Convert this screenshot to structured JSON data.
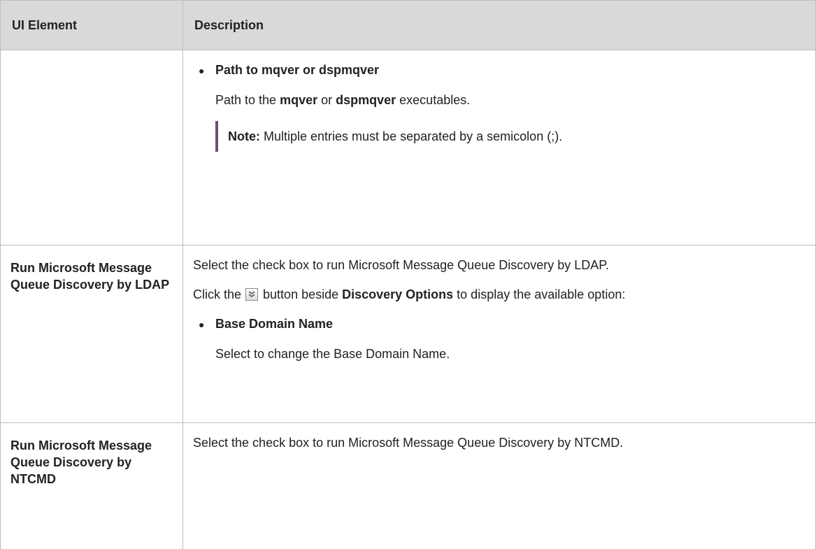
{
  "table": {
    "headers": {
      "element": "UI Element",
      "description": "Description"
    },
    "row1": {
      "element": "",
      "bullet_title": "Path to mqver or dspmqver",
      "desc_pre": "Path to the ",
      "desc_b1": "mqver",
      "desc_mid": " or ",
      "desc_b2": "dspmqver",
      "desc_post": " executables.",
      "note_label": "Note:",
      "note_text": " Multiple entries must be separated by a semicolon (;)."
    },
    "row2": {
      "element": "Run Microsoft Message Queue Discovery by LDAP",
      "line1": "Select the check box to run Microsoft Message Queue Discovery by LDAP.",
      "click_pre": "Click the ",
      "click_mid": " button beside ",
      "click_b": "Discovery Options",
      "click_post": " to display the available option:",
      "bullet_title": "Base Domain Name",
      "bullet_desc": "Select to change the Base Domain Name.",
      "icon": "expand-chevron-icon"
    },
    "row3": {
      "element": "Run Microsoft Message Queue Discovery by NTCMD",
      "line1": "Select the check box to run Microsoft Message Queue Discovery by NTCMD."
    }
  },
  "colors": {
    "header_bg": "#d9d9d9",
    "note_bar": "#6b4f6f",
    "border": "#bdbdbd"
  }
}
